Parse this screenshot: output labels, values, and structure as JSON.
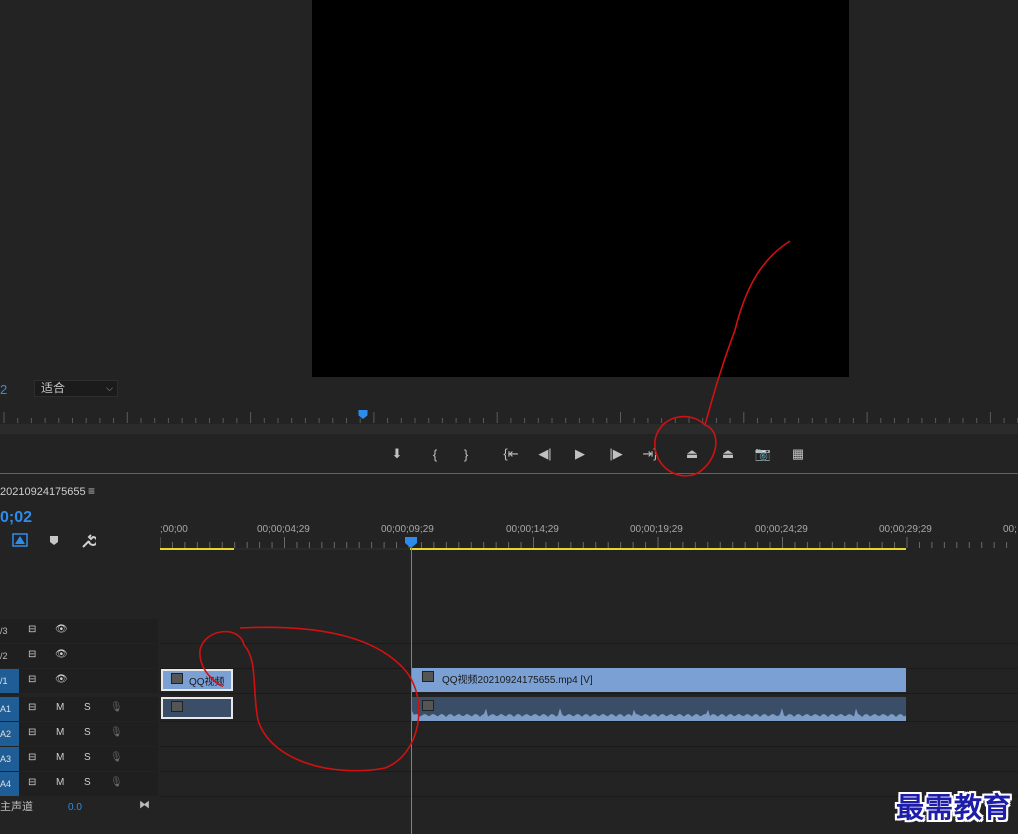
{
  "monitor": {
    "timecode_fragment": "2",
    "fit_select": {
      "value": "适合"
    },
    "controls": [
      {
        "name": "add-marker-button",
        "icon": "marker-icon",
        "glyph": "⬇"
      },
      {
        "name": "mark-in-button",
        "icon": "mark-in-icon",
        "glyph": "{"
      },
      {
        "name": "mark-out-button",
        "icon": "mark-out-icon",
        "glyph": "}"
      },
      {
        "name": "go-to-in-button",
        "icon": "go-to-in-icon",
        "glyph": "{⇤"
      },
      {
        "name": "step-back-button",
        "icon": "step-back-icon",
        "glyph": "◀|"
      },
      {
        "name": "play-button",
        "icon": "play-icon",
        "glyph": "▶"
      },
      {
        "name": "step-forward-button",
        "icon": "step-forward-icon",
        "glyph": "|▶"
      },
      {
        "name": "go-to-out-button",
        "icon": "go-to-out-icon",
        "glyph": "⇥}"
      },
      {
        "name": "lift-button",
        "icon": "lift-icon",
        "glyph": "⏏"
      },
      {
        "name": "extract-button",
        "icon": "extract-icon",
        "glyph": "⏏"
      },
      {
        "name": "export-frame-button",
        "icon": "camera-icon",
        "glyph": "📷"
      },
      {
        "name": "comparison-view-button",
        "icon": "comparison-icon",
        "glyph": "▦"
      }
    ]
  },
  "sequence": {
    "name": "20210924175655",
    "menu_icon": "hamburger-icon",
    "timecode": "0;02"
  },
  "ruler": {
    "labels": [
      ";00;00",
      "00;00;04;29",
      "00;00;09;29",
      "00;00;14;29",
      "00;00;19;29",
      "00;00;24;29",
      "00;00;29;29",
      "00;"
    ]
  },
  "tracks": [
    {
      "label": "/3",
      "type": "video",
      "active": false
    },
    {
      "label": "/2",
      "type": "video",
      "active": false
    },
    {
      "label": "/1",
      "type": "video",
      "active": true
    },
    {
      "label": "A1",
      "type": "audio",
      "active": true
    },
    {
      "label": "A2",
      "type": "audio",
      "active": true
    },
    {
      "label": "A3",
      "type": "audio",
      "active": true
    },
    {
      "label": "A4",
      "type": "audio",
      "active": true
    }
  ],
  "audio_buttons": {
    "mute": "M",
    "solo": "S"
  },
  "master": {
    "label": "主声道",
    "value": "0.0"
  },
  "clips": {
    "video_clip_1": {
      "label": "QQ视频"
    },
    "video_clip_2": {
      "label": "QQ视频20210924175655.mp4 [V]"
    }
  },
  "colors": {
    "accent_blue": "#2d8ceb",
    "clip_video": "#7ba0d4",
    "clip_audio": "#3b4e68",
    "annotation_red": "#d11111",
    "work_area": "#e6d52a"
  },
  "watermark": "最需教育"
}
